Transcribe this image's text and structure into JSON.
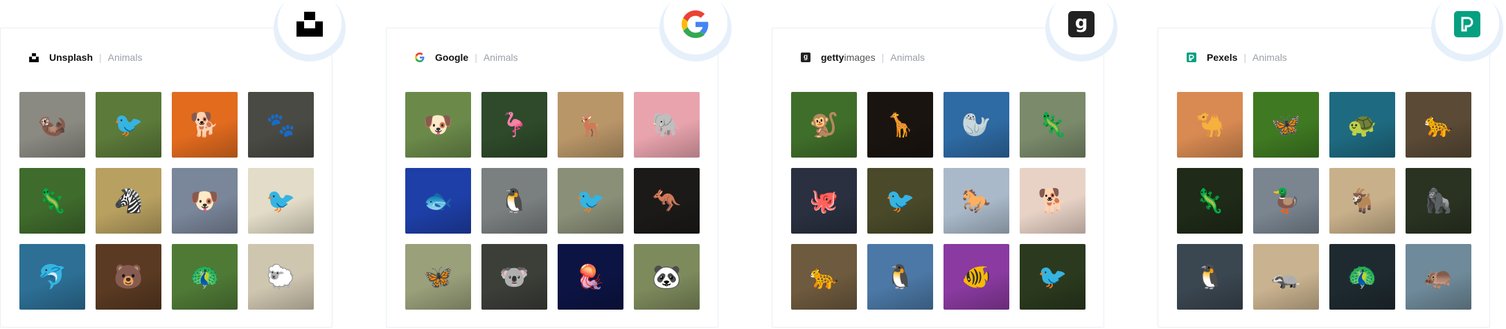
{
  "cards": [
    {
      "id": "unsplash",
      "name": "Unsplash",
      "category": "Animals",
      "logo_icon": "unsplash-logo-icon",
      "images": [
        {
          "alt": "otter",
          "bg": "#8a8a82",
          "glyph": "🦦"
        },
        {
          "alt": "hummingbird",
          "bg": "#5c7a3a",
          "glyph": "🐦"
        },
        {
          "alt": "corgi",
          "bg": "#e26b1e",
          "glyph": "🐕"
        },
        {
          "alt": "red panda",
          "bg": "#4a4a44",
          "glyph": "🐾"
        },
        {
          "alt": "chameleon",
          "bg": "#3f6b2c",
          "glyph": "🦎"
        },
        {
          "alt": "zebra",
          "bg": "#b8a060",
          "glyph": "🦓"
        },
        {
          "alt": "pug",
          "bg": "#7a869a",
          "glyph": "🐶"
        },
        {
          "alt": "robin",
          "bg": "#e3dcc8",
          "glyph": "🐦"
        },
        {
          "alt": "dolphins",
          "bg": "#2d6f95",
          "glyph": "🐬"
        },
        {
          "alt": "bear",
          "bg": "#5a3a22",
          "glyph": "🐻"
        },
        {
          "alt": "peacock",
          "bg": "#4f7a36",
          "glyph": "🦚"
        },
        {
          "alt": "sheep",
          "bg": "#cfc6b0",
          "glyph": "🐑"
        }
      ]
    },
    {
      "id": "google",
      "name": "Google",
      "category": "Animals",
      "logo_icon": "google-logo-icon",
      "images": [
        {
          "alt": "bulldog",
          "bg": "#6b8a4a",
          "glyph": "🐶"
        },
        {
          "alt": "flamingos",
          "bg": "#2e4a2a",
          "glyph": "🦩"
        },
        {
          "alt": "antelope",
          "bg": "#b99668",
          "glyph": "🦌"
        },
        {
          "alt": "elephants",
          "bg": "#e9a3ad",
          "glyph": "🐘"
        },
        {
          "alt": "tropical fish",
          "bg": "#1e3fa8",
          "glyph": "🐟"
        },
        {
          "alt": "puffin",
          "bg": "#7a7f80",
          "glyph": "🐧"
        },
        {
          "alt": "hummingbird",
          "bg": "#8a8f78",
          "glyph": "🐦"
        },
        {
          "alt": "kangaroo",
          "bg": "#1c1a18",
          "glyph": "🦘"
        },
        {
          "alt": "butterfly",
          "bg": "#9aa07a",
          "glyph": "🦋"
        },
        {
          "alt": "koala",
          "bg": "#3c3e38",
          "glyph": "🐨"
        },
        {
          "alt": "jellyfish",
          "bg": "#0c1444",
          "glyph": "🪼"
        },
        {
          "alt": "panda",
          "bg": "#7d8a5c",
          "glyph": "🐼"
        }
      ]
    },
    {
      "id": "getty",
      "name_bold": "getty",
      "name_light": "images",
      "category": "Animals",
      "logo_icon": "gettyimages-logo-icon",
      "images": [
        {
          "alt": "lemur",
          "bg": "#3f6e2a",
          "glyph": "🐒"
        },
        {
          "alt": "giraffe",
          "bg": "#1a1410",
          "glyph": "🦒"
        },
        {
          "alt": "seal",
          "bg": "#2e6aa3",
          "glyph": "🦭"
        },
        {
          "alt": "lizard",
          "bg": "#7a8a6a",
          "glyph": "🦎"
        },
        {
          "alt": "octopus",
          "bg": "#2a3040",
          "glyph": "🐙"
        },
        {
          "alt": "kingfisher",
          "bg": "#4a4a2a",
          "glyph": "🐦"
        },
        {
          "alt": "horse",
          "bg": "#a9b9c9",
          "glyph": "🐎"
        },
        {
          "alt": "terrier",
          "bg": "#e8d2c6",
          "glyph": "🐕"
        },
        {
          "alt": "leopard",
          "bg": "#6e5a3e",
          "glyph": "🐆"
        },
        {
          "alt": "penguins",
          "bg": "#4b78a6",
          "glyph": "🐧"
        },
        {
          "alt": "clownfish",
          "bg": "#8a3aa0",
          "glyph": "🐠"
        },
        {
          "alt": "toucan",
          "bg": "#2b3a1e",
          "glyph": "🐦"
        }
      ]
    },
    {
      "id": "pexels",
      "name": "Pexels",
      "category": "Animals",
      "logo_icon": "pexels-logo-icon",
      "images": [
        {
          "alt": "camel",
          "bg": "#d88a52",
          "glyph": "🐪"
        },
        {
          "alt": "butterfly",
          "bg": "#3f7a22",
          "glyph": "🦋"
        },
        {
          "alt": "sea turtle",
          "bg": "#1e6a80",
          "glyph": "🐢"
        },
        {
          "alt": "leopard",
          "bg": "#5a4a36",
          "glyph": "🐆"
        },
        {
          "alt": "chameleon",
          "bg": "#1f2a18",
          "glyph": "🦎"
        },
        {
          "alt": "mallard",
          "bg": "#7a8590",
          "glyph": "🦆"
        },
        {
          "alt": "goat",
          "bg": "#c8b08a",
          "glyph": "🐐"
        },
        {
          "alt": "gorilla",
          "bg": "#2a3322",
          "glyph": "🦍"
        },
        {
          "alt": "penguins",
          "bg": "#3a4650",
          "glyph": "🐧"
        },
        {
          "alt": "meerkats",
          "bg": "#c9b28f",
          "glyph": "🦡"
        },
        {
          "alt": "peacock",
          "bg": "#1e2a30",
          "glyph": "🦚"
        },
        {
          "alt": "hippo",
          "bg": "#6f8a9a",
          "glyph": "🦛"
        }
      ]
    }
  ]
}
